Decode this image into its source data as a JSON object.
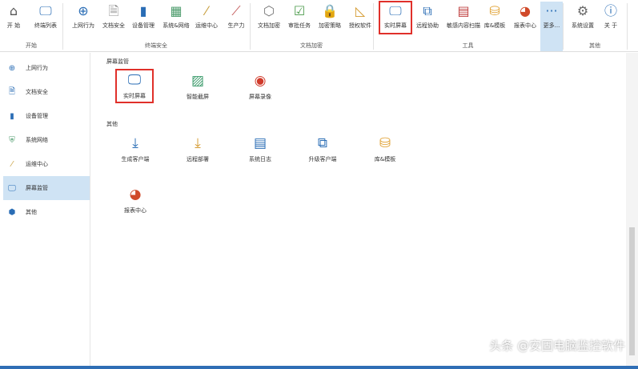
{
  "ribbon": {
    "buttons": [
      {
        "label": "开 始",
        "icon": "home-icon"
      },
      {
        "label": "终端列表",
        "icon": "monitors-icon"
      },
      {
        "label": "上网行为",
        "icon": "globe-search-icon"
      },
      {
        "label": "文档安全",
        "icon": "document-shield-icon"
      },
      {
        "label": "设备管理",
        "icon": "usb-device-icon"
      },
      {
        "label": "系统&网络",
        "icon": "firewall-icon"
      },
      {
        "label": "运维中心",
        "icon": "magic-wand-icon"
      },
      {
        "label": "生产力",
        "icon": "chart-person-icon"
      },
      {
        "label": "文档加密",
        "icon": "box-shield-icon"
      },
      {
        "label": "审批任务",
        "icon": "clipboard-check-icon"
      },
      {
        "label": "加密策略",
        "icon": "lock-window-icon"
      },
      {
        "label": "授权软件",
        "icon": "ruler-pencil-icon"
      },
      {
        "label": "实时屏幕",
        "icon": "monitor-icon"
      },
      {
        "label": "远程协助",
        "icon": "remote-network-icon"
      },
      {
        "label": "敏感内容扫描",
        "icon": "document-scan-icon"
      },
      {
        "label": "库&模板",
        "icon": "database-gear-icon"
      },
      {
        "label": "报表中心",
        "icon": "pie-chart-icon"
      },
      {
        "label": "更多...",
        "icon": "more-dots-icon"
      },
      {
        "label": "系统设置",
        "icon": "gear-icon"
      },
      {
        "label": "关 于",
        "icon": "info-icon"
      }
    ],
    "groups": [
      "开始",
      "终端安全",
      "文档加密",
      "工具",
      "其他"
    ],
    "selected": "实时屏幕"
  },
  "sidebar": {
    "items": [
      {
        "label": "上网行为",
        "icon": "globe-search-icon"
      },
      {
        "label": "文档安全",
        "icon": "document-icon"
      },
      {
        "label": "设备管理",
        "icon": "device-icon"
      },
      {
        "label": "系统网络",
        "icon": "network-icon"
      },
      {
        "label": "运维中心",
        "icon": "magic-wand-icon"
      },
      {
        "label": "屏幕监管",
        "icon": "monitor-icon"
      },
      {
        "label": "其他",
        "icon": "cube-icon"
      }
    ],
    "active": "屏幕监管"
  },
  "main": {
    "sections": [
      {
        "title": "屏幕监管",
        "items": [
          {
            "label": "实时屏幕",
            "icon": "monitor-icon"
          },
          {
            "label": "智能截屏",
            "icon": "image-icon"
          },
          {
            "label": "屏幕录像",
            "icon": "record-icon"
          }
        ]
      },
      {
        "title": "其他",
        "items": [
          {
            "label": "生成客户端",
            "icon": "download-icon"
          },
          {
            "label": "远程部署",
            "icon": "deploy-icon"
          },
          {
            "label": "系统日志",
            "icon": "log-icon"
          },
          {
            "label": "升级客户端",
            "icon": "upgrade-client-icon"
          },
          {
            "label": "库&模板",
            "icon": "database-gear-icon"
          },
          {
            "label": "报表中心",
            "icon": "pie-chart-icon"
          }
        ]
      }
    ]
  },
  "watermark": "头条 @安固电脑监控软件",
  "colors": {
    "accent": "#2f6eb5",
    "selection": "#cfe3f4",
    "highlight_border": "#e0302a"
  }
}
